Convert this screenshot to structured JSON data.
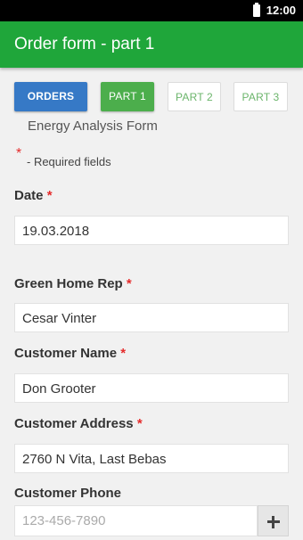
{
  "status_bar": {
    "time": "12:00"
  },
  "app_bar": {
    "title": "Order form - part 1"
  },
  "tabs": [
    {
      "label": "ORDERS"
    },
    {
      "label": "PART 1"
    },
    {
      "label": "PART 2"
    },
    {
      "label": "PART 3"
    }
  ],
  "form": {
    "title": "Energy Analysis Form",
    "required_star": "*",
    "required_note": "- Required fields",
    "fields": [
      {
        "label": "Date",
        "star": "*",
        "value": "19.03.2018"
      },
      {
        "label": "Green Home Rep",
        "star": "*",
        "value": "Cesar Vinter"
      },
      {
        "label": "Customer Name",
        "star": "*",
        "value": "Don Grooter"
      },
      {
        "label": "Customer Address",
        "star": "*",
        "value": "2760 N Vita, Last Bebas"
      },
      {
        "label": "Customer Phone",
        "star": "",
        "value": "",
        "placeholder": "123-456-7890"
      }
    ]
  },
  "icons": {
    "battery": "battery-icon",
    "add": "plus-icon"
  },
  "colors": {
    "app_bar": "#1fa63a",
    "orders_tab": "#3679c6",
    "active_part_tab": "#4cae4c",
    "required": "#e52b2b"
  }
}
